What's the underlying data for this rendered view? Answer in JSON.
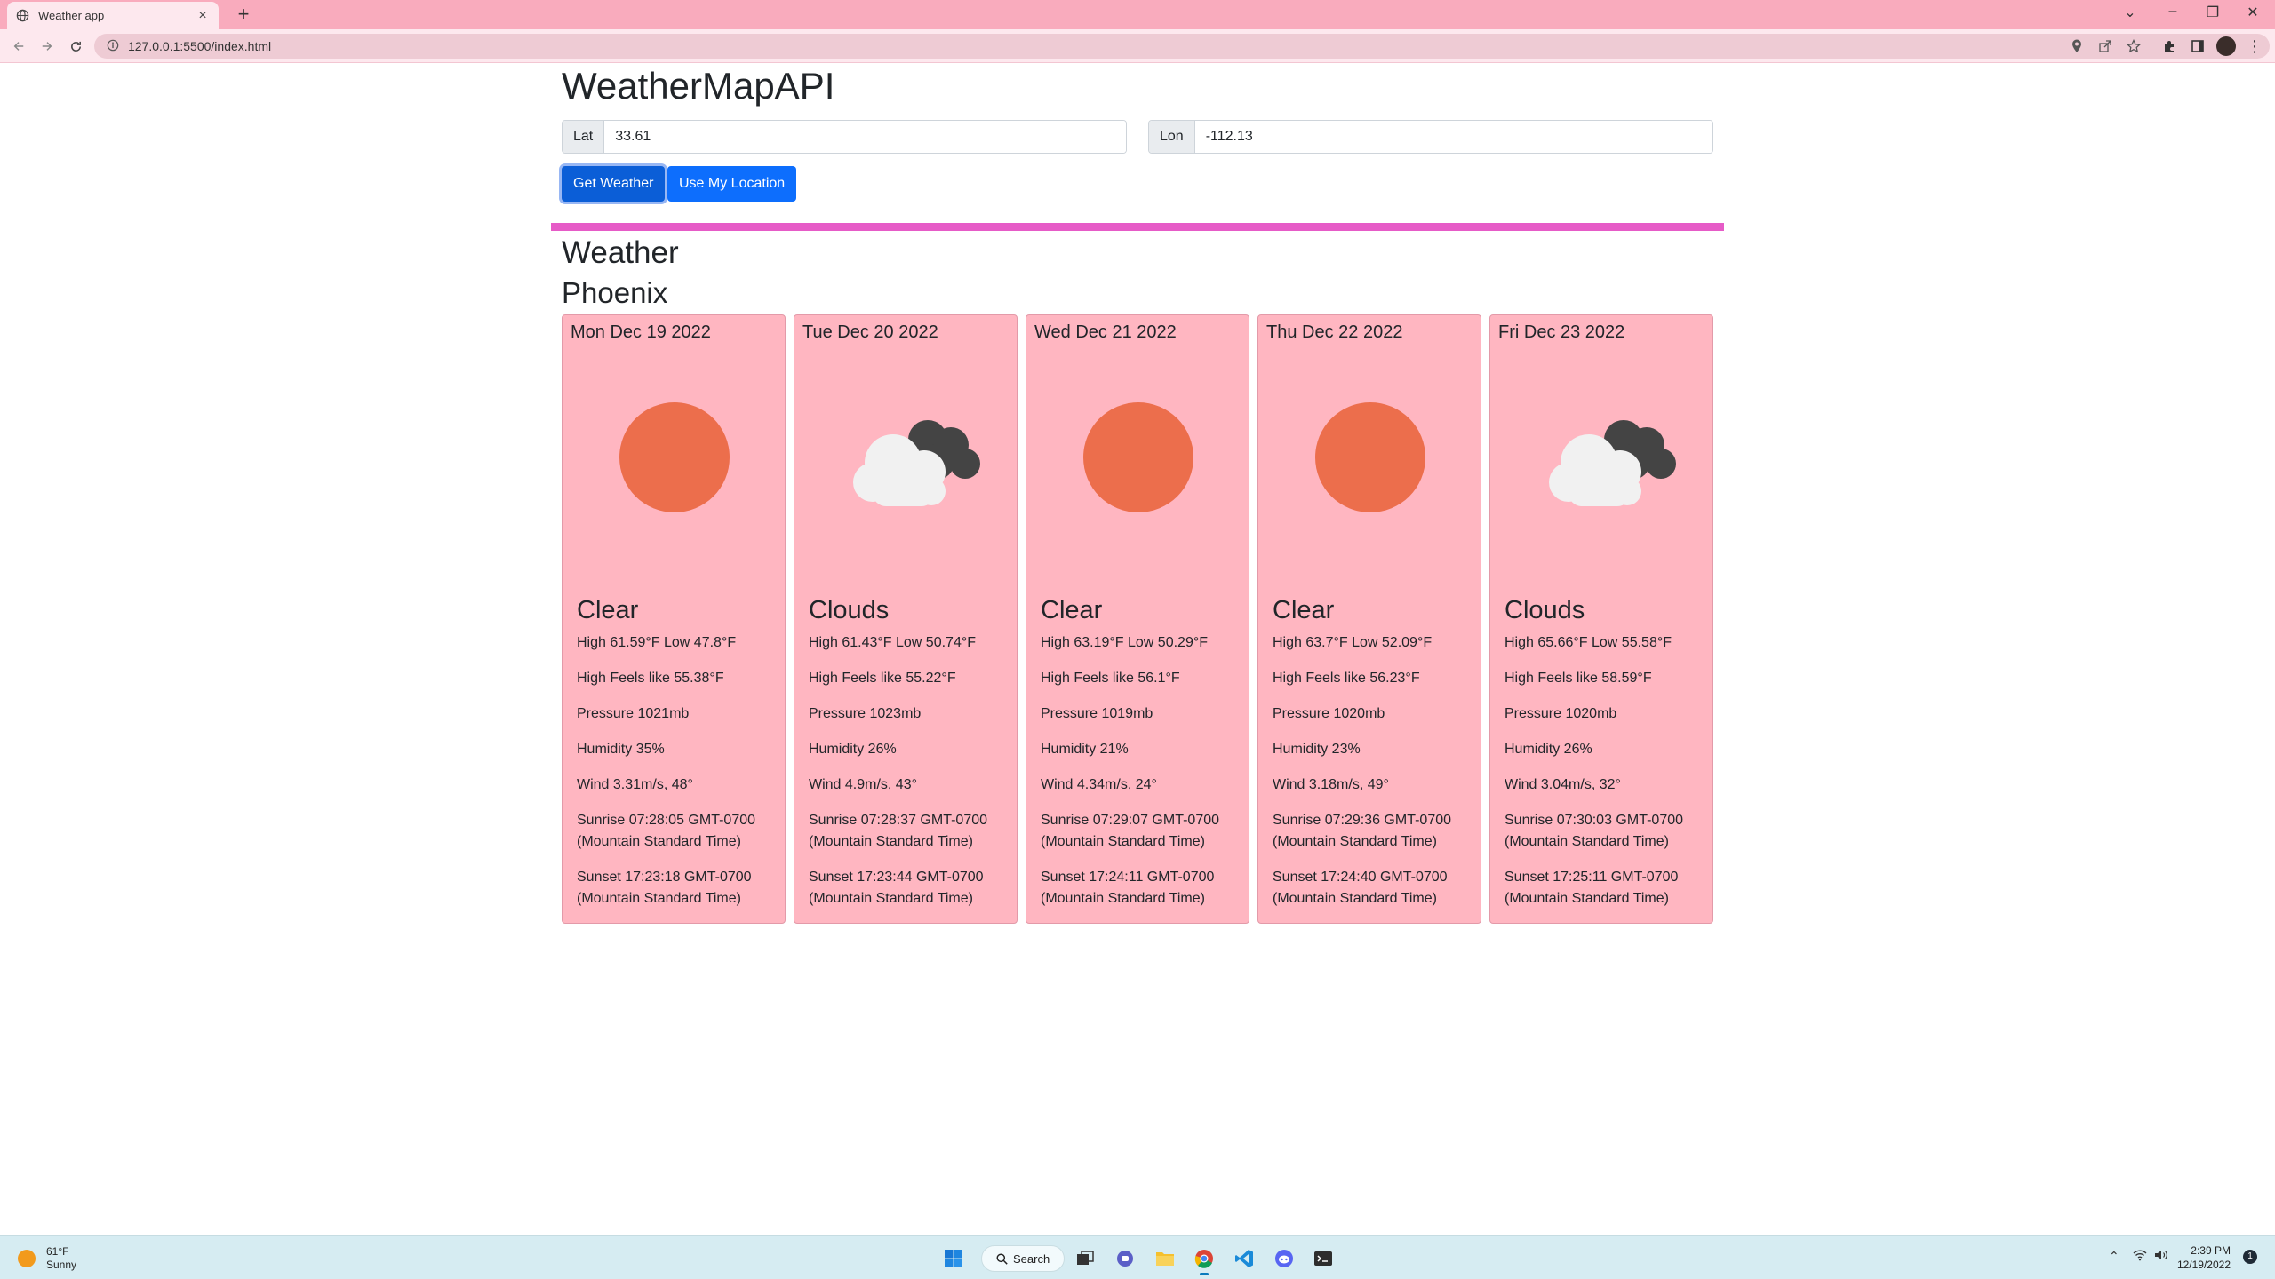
{
  "browser": {
    "tab_title": "Weather app",
    "url": "127.0.0.1:5500/index.html"
  },
  "app": {
    "title": "WeatherMapAPI",
    "lat_label": "Lat",
    "lat_value": "33.61",
    "lon_label": "Lon",
    "lon_value": "-112.13",
    "get_weather_label": "Get Weather",
    "use_location_label": "Use My Location",
    "section_title": "Weather",
    "city": "Phoenix",
    "accent_color": "#e65bc7",
    "card_color": "#ffb6c1",
    "forecast": [
      {
        "date": "Mon Dec 19 2022",
        "icon": "sun-icon",
        "desc": "Clear",
        "high_low": "High 61.59°F Low 47.8°F",
        "feels": "High Feels like 55.38°F",
        "pressure": "Pressure 1021mb",
        "humidity": "Humidity 35%",
        "wind": "Wind 3.31m/s, 48°",
        "sunrise": "Sunrise 07:28:05 GMT-0700 (Mountain Standard Time)",
        "sunset": "Sunset 17:23:18 GMT-0700 (Mountain Standard Time)"
      },
      {
        "date": "Tue Dec 20 2022",
        "icon": "clouds-icon",
        "desc": "Clouds",
        "high_low": "High 61.43°F Low 50.74°F",
        "feels": "High Feels like 55.22°F",
        "pressure": "Pressure 1023mb",
        "humidity": "Humidity 26%",
        "wind": "Wind 4.9m/s, 43°",
        "sunrise": "Sunrise 07:28:37 GMT-0700 (Mountain Standard Time)",
        "sunset": "Sunset 17:23:44 GMT-0700 (Mountain Standard Time)"
      },
      {
        "date": "Wed Dec 21 2022",
        "icon": "sun-icon",
        "desc": "Clear",
        "high_low": "High 63.19°F Low 50.29°F",
        "feels": "High Feels like 56.1°F",
        "pressure": "Pressure 1019mb",
        "humidity": "Humidity 21%",
        "wind": "Wind 4.34m/s, 24°",
        "sunrise": "Sunrise 07:29:07 GMT-0700 (Mountain Standard Time)",
        "sunset": "Sunset 17:24:11 GMT-0700 (Mountain Standard Time)"
      },
      {
        "date": "Thu Dec 22 2022",
        "icon": "sun-icon",
        "desc": "Clear",
        "high_low": "High 63.7°F Low 52.09°F",
        "feels": "High Feels like 56.23°F",
        "pressure": "Pressure 1020mb",
        "humidity": "Humidity 23%",
        "wind": "Wind 3.18m/s, 49°",
        "sunrise": "Sunrise 07:29:36 GMT-0700 (Mountain Standard Time)",
        "sunset": "Sunset 17:24:40 GMT-0700 (Mountain Standard Time)"
      },
      {
        "date": "Fri Dec 23 2022",
        "icon": "clouds-icon",
        "desc": "Clouds",
        "high_low": "High 65.66°F Low 55.58°F",
        "feels": "High Feels like 58.59°F",
        "pressure": "Pressure 1020mb",
        "humidity": "Humidity 26%",
        "wind": "Wind 3.04m/s, 32°",
        "sunrise": "Sunrise 07:30:03 GMT-0700 (Mountain Standard Time)",
        "sunset": "Sunset 17:25:11 GMT-0700 (Mountain Standard Time)"
      }
    ]
  },
  "taskbar": {
    "weather_temp": "61°F",
    "weather_desc": "Sunny",
    "search_label": "Search",
    "time": "2:39 PM",
    "date": "12/19/2022",
    "notification_count": "1"
  }
}
